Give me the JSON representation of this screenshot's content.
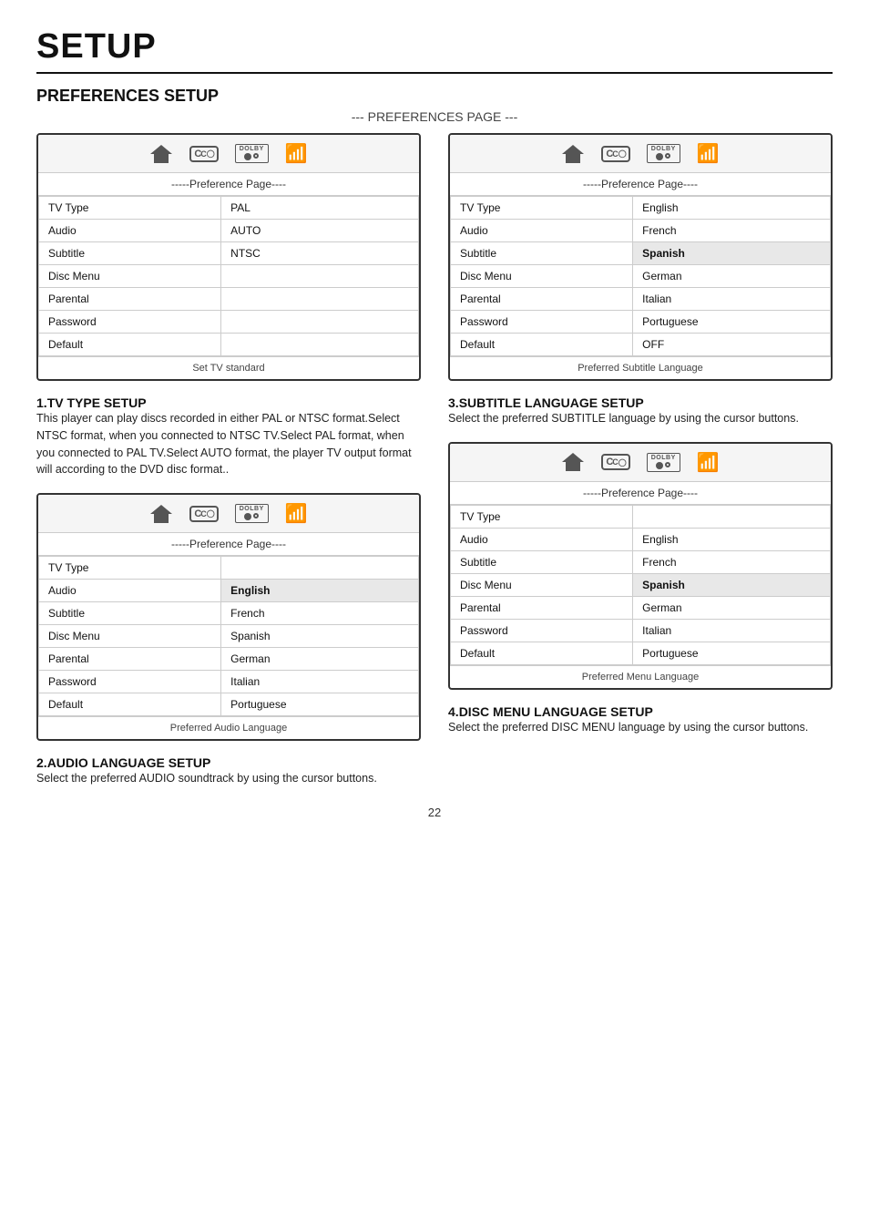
{
  "page": {
    "title": "SETUP",
    "section_title": "PREFERENCES SETUP",
    "page_label": "--- PREFERENCES PAGE ---",
    "page_number": "22"
  },
  "icon_labels": {
    "cc": "CC",
    "dolby": "DOLBY",
    "dolby_sub": "■D"
  },
  "screen_header": "-----Preference Page----",
  "screens": {
    "screen1": {
      "header": "-----Preference Page----",
      "rows": [
        {
          "label": "TV Type",
          "value": "PAL",
          "highlight": false
        },
        {
          "label": "Audio",
          "value": "AUTO",
          "highlight": false
        },
        {
          "label": "Subtitle",
          "value": "NTSC",
          "highlight": false
        },
        {
          "label": "Disc Menu",
          "value": "",
          "highlight": false
        },
        {
          "label": "Parental",
          "value": "",
          "highlight": false
        },
        {
          "label": "Password",
          "value": "",
          "highlight": false
        },
        {
          "label": "Default",
          "value": "",
          "highlight": false
        }
      ],
      "footer": "Set TV standard"
    },
    "screen2": {
      "header": "-----Preference Page----",
      "rows": [
        {
          "label": "TV Type",
          "value": "English",
          "highlight": false
        },
        {
          "label": "Audio",
          "value": "French",
          "highlight": false
        },
        {
          "label": "Subtitle",
          "value": "Spanish",
          "highlight": true
        },
        {
          "label": "Disc Menu",
          "value": "German",
          "highlight": false
        },
        {
          "label": "Parental",
          "value": "Italian",
          "highlight": false
        },
        {
          "label": "Password",
          "value": "Portuguese",
          "highlight": false
        },
        {
          "label": "Default",
          "value": "OFF",
          "highlight": false
        }
      ],
      "footer": "Preferred Subtitle Language"
    },
    "screen3": {
      "header": "-----Preference Page----",
      "rows": [
        {
          "label": "TV Type",
          "value": "",
          "highlight": false
        },
        {
          "label": "Audio",
          "value": "English",
          "highlight": true
        },
        {
          "label": "Subtitle",
          "value": "French",
          "highlight": false
        },
        {
          "label": "Disc Menu",
          "value": "Spanish",
          "highlight": false
        },
        {
          "label": "Parental",
          "value": "German",
          "highlight": false
        },
        {
          "label": "Password",
          "value": "Italian",
          "highlight": false
        },
        {
          "label": "Default",
          "value": "Portuguese",
          "highlight": false
        }
      ],
      "footer": "Preferred Audio Language"
    },
    "screen4": {
      "header": "-----Preference Page----",
      "rows": [
        {
          "label": "TV Type",
          "value": "",
          "highlight": false
        },
        {
          "label": "Audio",
          "value": "English",
          "highlight": false
        },
        {
          "label": "Subtitle",
          "value": "French",
          "highlight": false
        },
        {
          "label": "Disc Menu",
          "value": "Spanish",
          "highlight": true
        },
        {
          "label": "Parental",
          "value": "German",
          "highlight": false
        },
        {
          "label": "Password",
          "value": "Italian",
          "highlight": false
        },
        {
          "label": "Default",
          "value": "Portuguese",
          "highlight": false
        }
      ],
      "footer": "Preferred Menu Language"
    }
  },
  "sections": {
    "s1": {
      "number": "1.",
      "title": "TV TYPE SETUP",
      "body": "This player can play discs recorded in either PAL or NTSC format.Select NTSC format, when you connected to NTSC TV.Select PAL format, when you connected to PAL TV.Select AUTO format, the player TV output format will according to the DVD disc format.."
    },
    "s2": {
      "number": "2.",
      "title": "AUDIO LANGUAGE SETUP",
      "body": "Select the preferred AUDIO soundtrack by using the cursor buttons."
    },
    "s3": {
      "number": "3.",
      "title": "SUBTITLE LANGUAGE SETUP",
      "body": "Select the preferred SUBTITLE language by using the cursor buttons."
    },
    "s4": {
      "number": "4.",
      "title": "DISC MENU LANGUAGE SETUP",
      "body": "Select the preferred DISC MENU language by using the cursor buttons."
    }
  }
}
